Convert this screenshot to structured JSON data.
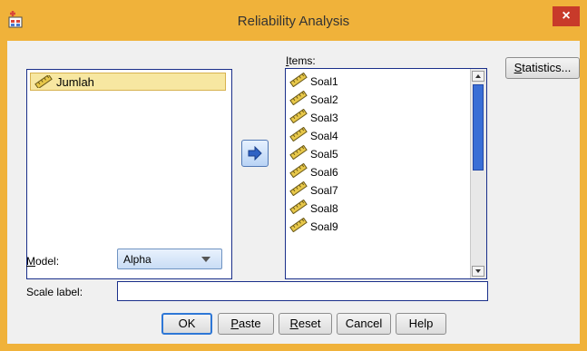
{
  "window": {
    "title": "Reliability Analysis",
    "close_glyph": "×"
  },
  "source_list": {
    "items": [
      {
        "label": "Jumlah",
        "icon": "ruler-icon"
      }
    ]
  },
  "items_list": {
    "label_first": "I",
    "label_rest": "tems:",
    "items": [
      {
        "label": "Soal1"
      },
      {
        "label": "Soal2"
      },
      {
        "label": "Soal3"
      },
      {
        "label": "Soal4"
      },
      {
        "label": "Soal5"
      },
      {
        "label": "Soal6"
      },
      {
        "label": "Soal7"
      },
      {
        "label": "Soal8"
      },
      {
        "label": "Soal9"
      }
    ]
  },
  "buttons": {
    "statistics_first": "S",
    "statistics_rest": "tatistics...",
    "ok": "OK",
    "paste_first": "P",
    "paste_rest": "aste",
    "reset_first": "R",
    "reset_rest": "eset",
    "cancel": "Cancel",
    "help": "Help"
  },
  "model": {
    "label_first": "M",
    "label_rest": "odel:",
    "selected": "Alpha"
  },
  "scale": {
    "label": "Scale label:",
    "value": ""
  },
  "colors": {
    "title_bar": "#f0b23a",
    "close": "#c83a2a",
    "list_border": "#1a2f8a",
    "selection": "#f7e7a1",
    "scroll_thumb": "#3a6fd6"
  }
}
